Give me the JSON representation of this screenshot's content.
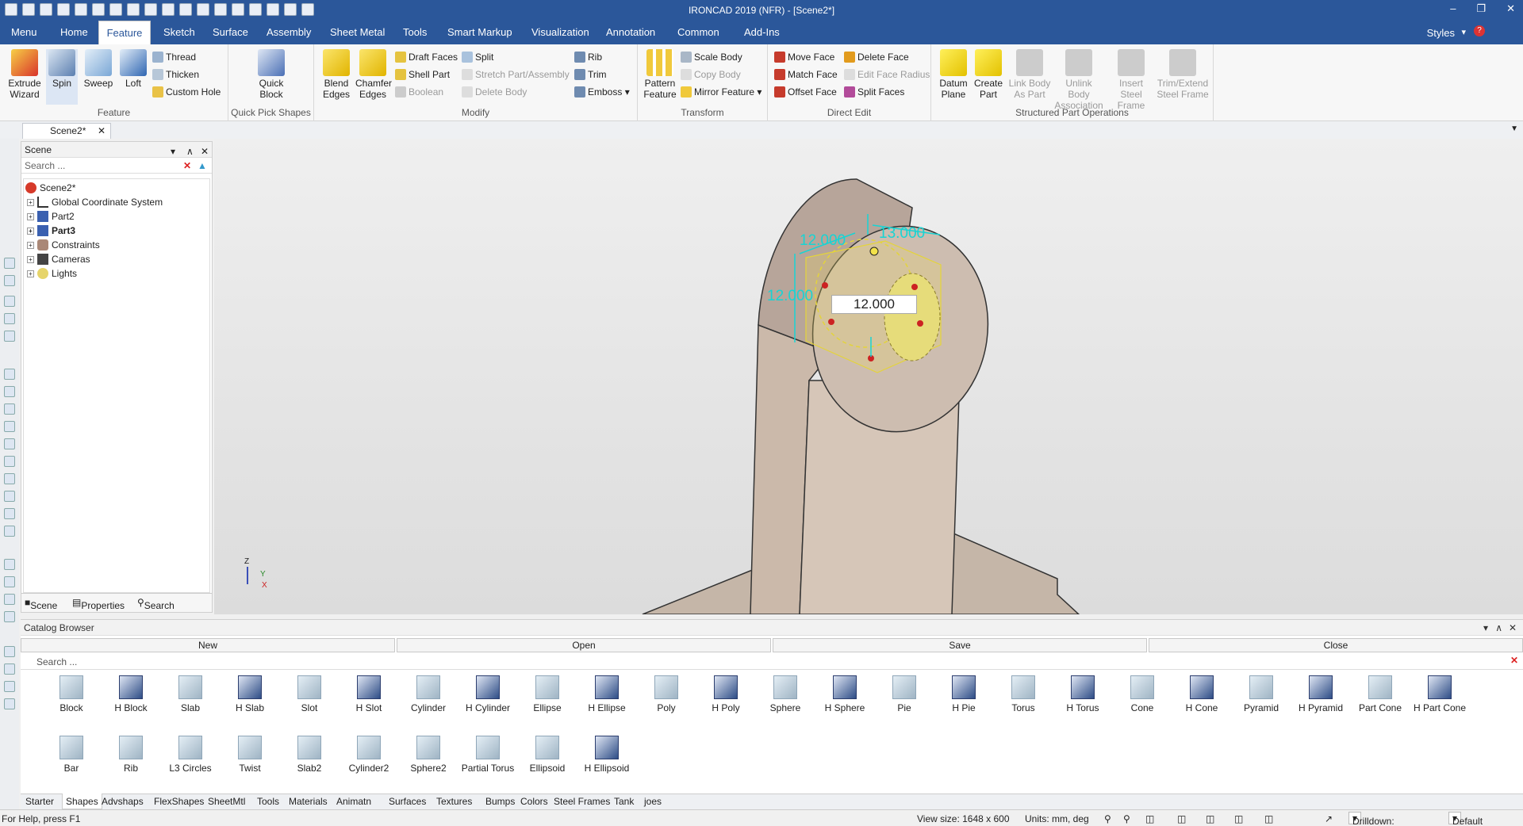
{
  "window": {
    "title": "IRONCAD 2019 (NFR) - [Scene2*]"
  },
  "menubar": {
    "tabs": [
      {
        "label": "Menu"
      },
      {
        "label": "Home"
      },
      {
        "label": "Feature"
      },
      {
        "label": "Sketch"
      },
      {
        "label": "Surface"
      },
      {
        "label": "Assembly"
      },
      {
        "label": "Sheet Metal"
      },
      {
        "label": "Tools"
      },
      {
        "label": "Smart Markup"
      },
      {
        "label": "Visualization"
      },
      {
        "label": "Annotation"
      },
      {
        "label": "Common"
      },
      {
        "label": "Add-Ins"
      }
    ],
    "active": "Feature",
    "styles_label": "Styles"
  },
  "ribbon": {
    "feature": {
      "group": "Feature",
      "extrude": "Extrude Wizard",
      "spin": "Spin",
      "sweep": "Sweep",
      "loft": "Loft",
      "thread": "Thread",
      "thicken": "Thicken",
      "custom_hole": "Custom Hole"
    },
    "quick": {
      "group": "Quick Pick Shapes",
      "quick_block": "Quick Block"
    },
    "modify": {
      "group": "Modify",
      "blend": "Blend Edges",
      "chamfer": "Chamfer Edges",
      "draft": "Draft Faces",
      "shell": "Shell Part",
      "boolean": "Boolean",
      "split": "Split",
      "stretch": "Stretch Part/Assembly",
      "delete_body": "Delete Body",
      "rib": "Rib",
      "trim": "Trim",
      "emboss": "Emboss"
    },
    "transform": {
      "group": "Transform",
      "pattern": "Pattern Feature",
      "scale_body": "Scale Body",
      "copy_body": "Copy Body",
      "mirror": "Mirror Feature"
    },
    "direct": {
      "group": "Direct Edit",
      "move_face": "Move Face",
      "match_face": "Match Face",
      "offset_face": "Offset Face",
      "delete_face": "Delete Face",
      "edit_radius": "Edit Face Radius",
      "split_faces": "Split Faces"
    },
    "structured": {
      "group": "Structured Part Operations",
      "datum": "Datum Plane",
      "create_part": "Create Part",
      "link_body": "Link Body As Part",
      "unlink": "Unlink Body Association",
      "insert_steel": "Insert Steel Frame",
      "trim_extend": "Trim/Extend Steel Frame"
    }
  },
  "doc_tab": {
    "label": "Scene2*"
  },
  "scene_panel": {
    "title": "Scene",
    "search_placeholder": "Search ...",
    "tree": [
      {
        "label": "Scene2*",
        "bold": false
      },
      {
        "label": "Global Coordinate System",
        "bold": false
      },
      {
        "label": "Part2",
        "bold": false
      },
      {
        "label": "Part3",
        "bold": true
      },
      {
        "label": "Constraints",
        "bold": false
      },
      {
        "label": "Cameras",
        "bold": false
      },
      {
        "label": "Lights",
        "bold": false
      }
    ],
    "footer_tabs": [
      {
        "label": "Scene"
      },
      {
        "label": "Properties"
      },
      {
        "label": "Search"
      }
    ]
  },
  "viewport": {
    "dims": [
      "12.000",
      "13.000",
      "12.000"
    ],
    "edit_value": "12.000",
    "axes": {
      "z": "Z",
      "y": "Y",
      "x": "X"
    }
  },
  "catalog": {
    "title": "Catalog Browser",
    "buttons": {
      "new": "New",
      "open": "Open",
      "save": "Save",
      "close": "Close"
    },
    "search_placeholder": "Search ...",
    "row1": [
      "Block",
      "H Block",
      "Slab",
      "H Slab",
      "Slot",
      "H Slot",
      "Cylinder",
      "H Cylinder",
      "Ellipse",
      "H Ellipse",
      "Poly",
      "H Poly",
      "Sphere",
      "H Sphere",
      "Pie",
      "H Pie",
      "Torus",
      "H Torus",
      "Cone",
      "H Cone",
      "Pyramid",
      "H Pyramid",
      "Part Cone",
      "H Part Cone"
    ],
    "row2": [
      "Bar",
      "Rib",
      "L3 Circles",
      "Twist",
      "Slab2",
      "Cylinder2",
      "Sphere2",
      "Partial Torus",
      "Ellipsoid",
      "H Ellipsoid"
    ],
    "tabs": [
      "Starter",
      "Shapes",
      "Advshaps",
      "FlexShapes",
      "SheetMtl",
      "Tools",
      "Materials",
      "Animatn",
      "Surfaces",
      "Textures",
      "Bumps",
      "Colors",
      "Steel Frames",
      "Tank",
      "joes"
    ],
    "active_tab": "Shapes"
  },
  "status": {
    "help": "For Help, press F1",
    "view_size": "View size: 1648 x  600",
    "units": "Units: mm, deg",
    "drilldown": "Drilldown: Int",
    "default": "Default"
  }
}
